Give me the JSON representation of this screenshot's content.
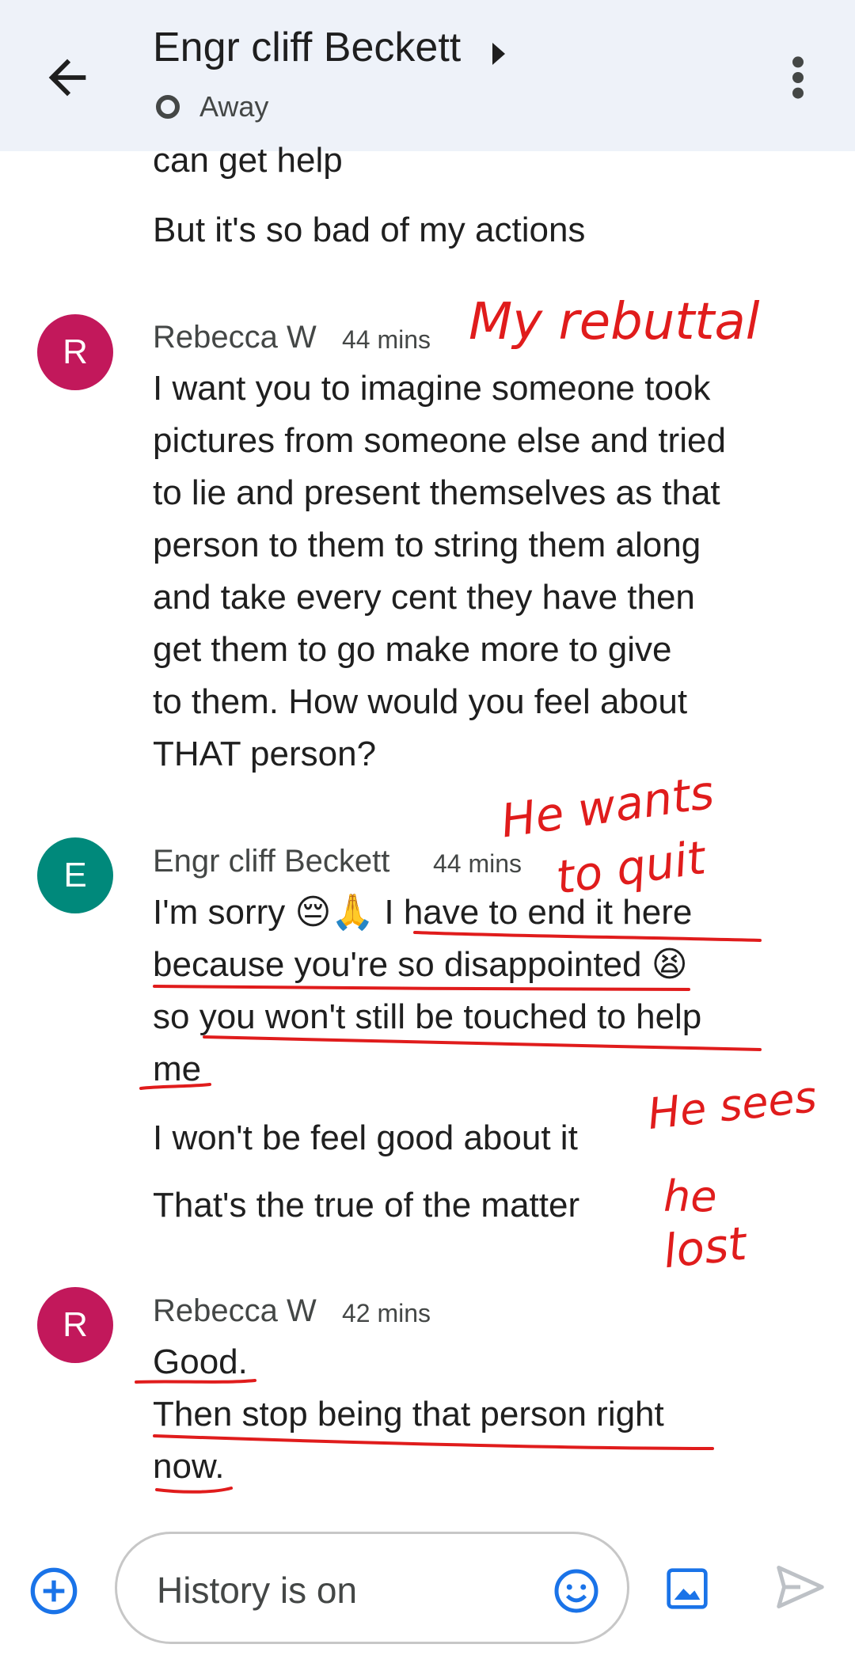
{
  "header": {
    "title": "Engr cliff Beckett",
    "status": "Away",
    "icons": [
      "arrow-left-icon",
      "caret-right-icon",
      "away-status-icon",
      "more-vert-icon"
    ]
  },
  "messages": {
    "top_cut": "can get help",
    "top_line2": "But it's so bad of my actions",
    "group1": {
      "avatar": "R",
      "sender": "Rebecca W",
      "time": "44 mins",
      "lines": [
        "I want you to imagine someone took",
        "pictures from someone else and tried",
        "to lie and present themselves as that",
        "person to them to string them along",
        "and take every cent they have then",
        "get them to go make more to give",
        "to them. How would you feel about",
        "THAT person?"
      ]
    },
    "group2": {
      "avatar": "E",
      "sender": "Engr cliff Beckett",
      "time": "44 mins",
      "lines": [
        "I'm sorry 😔🙏 I have to end it here",
        "because you're so disappointed 😫",
        "so you won't still be touched to help",
        "me"
      ],
      "msg2": "I won't be feel good about it",
      "msg3": "That's the true of the matter"
    },
    "group3": {
      "avatar": "R",
      "sender": "Rebecca W",
      "time": "42 mins",
      "lines": [
        "Good.",
        "Then stop being that person right",
        "now."
      ]
    }
  },
  "annotations": {
    "rebuttal": "My rebuttal",
    "wants_line1": "He wants",
    "wants_line2": "to quit",
    "sees_line1": "He sees",
    "sees_line2": "he",
    "sees_line3": "lost",
    "ink_color": "#e01c1c"
  },
  "composer": {
    "placeholder": "History is on",
    "icons": [
      "add-circle-icon",
      "emoji-icon",
      "image-icon",
      "send-icon"
    ],
    "accent": "#1a73e8"
  }
}
